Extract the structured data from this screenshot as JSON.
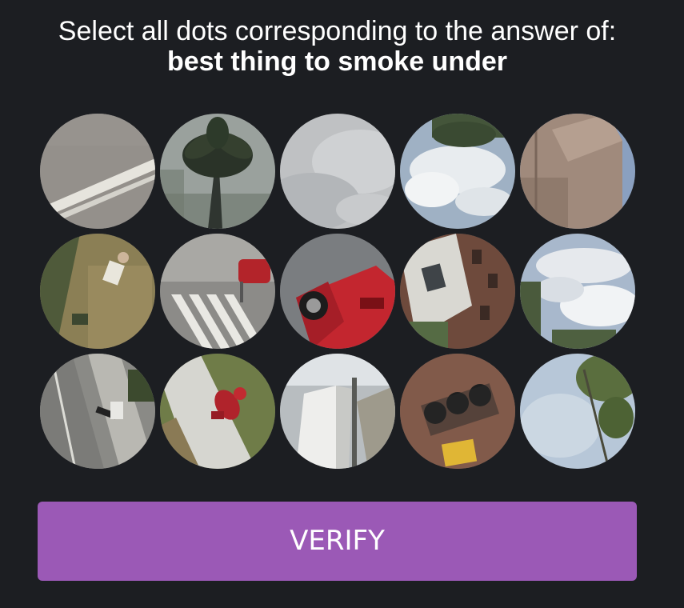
{
  "prompt": {
    "instruction": "Select all dots corresponding to the answer of:",
    "query": "best thing to smoke under"
  },
  "dots": [
    {
      "depicts": "road-lines"
    },
    {
      "depicts": "palm-tree"
    },
    {
      "depicts": "overcast-sky"
    },
    {
      "depicts": "sky-with-foliage"
    },
    {
      "depicts": "building-wall"
    },
    {
      "depicts": "person-on-grass"
    },
    {
      "depicts": "crosswalk-red-car"
    },
    {
      "depicts": "red-car"
    },
    {
      "depicts": "brick-building"
    },
    {
      "depicts": "cloudy-sky"
    },
    {
      "depicts": "person-on-sidewalk"
    },
    {
      "depicts": "fire-hydrant"
    },
    {
      "depicts": "parked-car"
    },
    {
      "depicts": "traffic-light"
    },
    {
      "depicts": "tree-and-sky"
    }
  ],
  "verify_button": {
    "label": "VERIFY"
  },
  "colors": {
    "background": "#1c1e22",
    "accent": "#9b59b6",
    "text": "#ffffff"
  }
}
